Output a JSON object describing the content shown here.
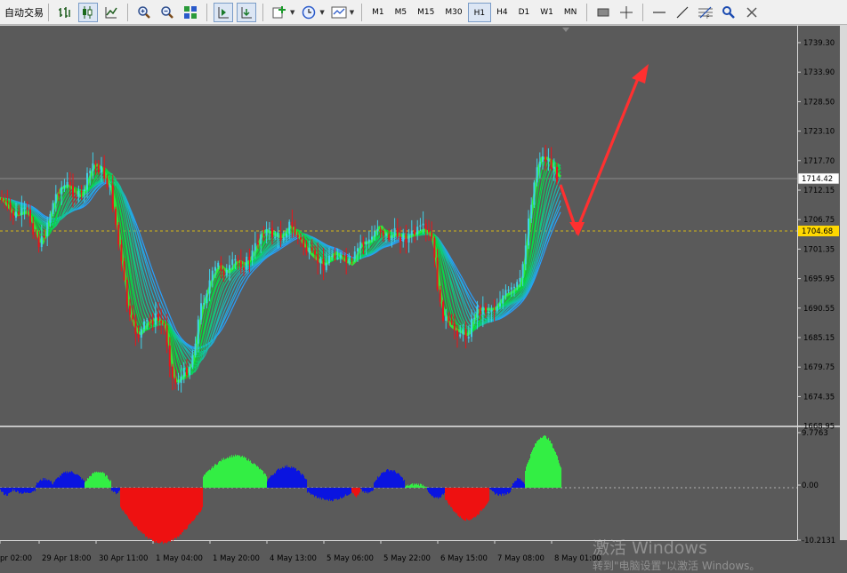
{
  "toolbar": {
    "auto_trading_label": "自动交易",
    "timeframes": [
      "M1",
      "M5",
      "M15",
      "M30",
      "H1",
      "H4",
      "D1",
      "W1",
      "MN"
    ],
    "active_timeframe": "H1"
  },
  "price_axis": {
    "ticks": [
      "1739.30",
      "1733.90",
      "1728.50",
      "1723.10",
      "1717.70",
      "1712.15",
      "1706.75",
      "1701.35",
      "1695.95",
      "1690.55",
      "1685.15",
      "1679.75",
      "1674.35",
      "1668.95"
    ],
    "current_price": "1714.42",
    "marked_level": "1704.68"
  },
  "indicator_axis": {
    "ticks": [
      "9.7763",
      "0.00",
      "-10.2131"
    ]
  },
  "time_axis": {
    "labels": [
      "pr 02:00",
      "29 Apr 18:00",
      "30 Apr 11:00",
      "1 May 04:00",
      "1 May 20:00",
      "4 May 13:00",
      "5 May 06:00",
      "5 May 22:00",
      "6 May 15:00",
      "7 May 08:00",
      "8 May 01:00"
    ]
  },
  "watermark": {
    "line1": "激活 Windows",
    "line2": "转到\"电脑设置\"以激活 Windows。"
  },
  "colors": {
    "background": "#5a5a5a",
    "bull_candle": "#3fd0e8",
    "bear_candle": "#e8151b",
    "ribbon_fast": "#00e61e",
    "ribbon_slow": "#2aa8ff",
    "level_line": "#ffd800",
    "arrow": "#ff3030",
    "hist_green": "#33ee44",
    "hist_blue": "#0a14e0",
    "hist_red": "#ee1111"
  }
}
